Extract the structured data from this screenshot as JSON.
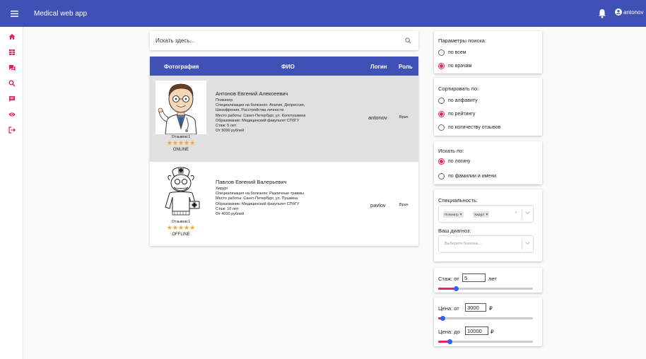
{
  "app": {
    "title": "Medical web app",
    "account": "antonov"
  },
  "search": {
    "placeholder": "Искать здесь..."
  },
  "table": {
    "headers": {
      "photo": "Фотография",
      "name": "ФИО",
      "login": "Логин",
      "role": "Роль"
    },
    "rows": [
      {
        "name": "Антонов Евгений Алексеевич",
        "specialty": "Психиатр",
        "diseases": "Специализация на болезнях: Апатия, Депрессия,",
        "diseases2": "Шизофрения, Расстройства личности",
        "workplace": "Место работы: Санкт-Петербург, ул. Колотушкина",
        "education": "Образование: Медицинский факультет СПбГУ",
        "experience": "Стаж: 5 лет",
        "price": "От 5000 рублей",
        "reviews": "Отзывов:1",
        "stars": "★★★★★",
        "rating": 5,
        "status": "ONLINE",
        "login": "antonov",
        "role": "Врач"
      },
      {
        "name": "Павлов Евгений Валерьевич",
        "specialty": "Хирург",
        "diseases": "Специализация на болезнях: Различные травмы",
        "workplace": "Место работы: Санкт-Петербург, ул. Пушкина",
        "education": "Образование: Медицинский факультет СПбГУ",
        "experience": "Стаж: 10 лет",
        "price": "От 4000 рублей",
        "reviews": "Отзывов:1",
        "stars": "★★★★★",
        "rating": 5,
        "status": "OFFLINE",
        "login": "pavlov",
        "role": "Врач"
      }
    ]
  },
  "filters": {
    "search_params": {
      "title": "Параметры поиска:",
      "options": [
        "по всем",
        "по врачам"
      ],
      "selected": 1
    },
    "sort": {
      "title": "Сортировать по:",
      "options": [
        "по алфавиту",
        "по рейтингу",
        "по количеству отзывов"
      ],
      "selected": 1
    },
    "search_by": {
      "title": "Искать по:",
      "options": [
        "по логину",
        "по фамилии и имени"
      ],
      "selected": 0
    },
    "specialty": {
      "title": "Специальность:",
      "chips": [
        "Психиатр",
        "Хирург"
      ],
      "diagnosis_label": "Ваш диагноз:",
      "diagnosis_placeholder": "Выберите болезнь..."
    },
    "experience": {
      "label_from": "Стаж: от",
      "value": "5",
      "unit": "лет",
      "slider_fraction": 0.19
    },
    "price": {
      "label_from": "Цена: от",
      "from_value": "3000",
      "label_to": "Цена: до",
      "to_value": "10000",
      "currency": "₽",
      "from_fraction": 0.05,
      "to_fraction": 0.12
    }
  },
  "colors": {
    "primary": "#3f51b5",
    "accent": "#e91e63",
    "star": "#f5a623"
  }
}
